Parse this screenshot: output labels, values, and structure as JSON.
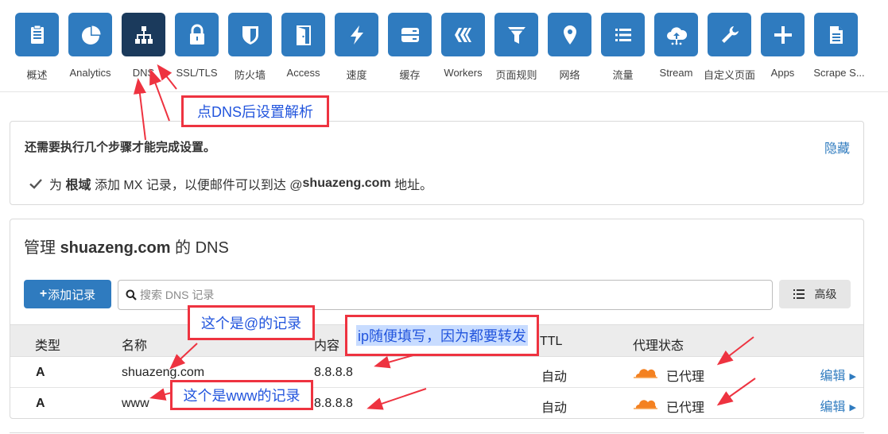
{
  "nav": {
    "items": [
      {
        "label": "概述",
        "icon": "clipboard-icon"
      },
      {
        "label": "Analytics",
        "icon": "pie-chart-icon"
      },
      {
        "label": "DNS",
        "icon": "network-icon"
      },
      {
        "label": "SSL/TLS",
        "icon": "lock-icon"
      },
      {
        "label": "防火墙",
        "icon": "shield-icon"
      },
      {
        "label": "Access",
        "icon": "door-icon"
      },
      {
        "label": "速度",
        "icon": "lightning-icon"
      },
      {
        "label": "缓存",
        "icon": "server-icon"
      },
      {
        "label": "Workers",
        "icon": "workers-icon"
      },
      {
        "label": "页面规则",
        "icon": "filter-icon"
      },
      {
        "label": "网络",
        "icon": "location-pin-icon"
      },
      {
        "label": "流量",
        "icon": "list-icon"
      },
      {
        "label": "Stream",
        "icon": "cloud-upload-icon"
      },
      {
        "label": "自定义页面",
        "icon": "wrench-icon"
      },
      {
        "label": "Apps",
        "icon": "plus-icon"
      },
      {
        "label": "Scrape S...",
        "icon": "document-icon"
      }
    ],
    "active": "DNS"
  },
  "setup": {
    "title": "还需要执行几个步骤才能完成设置。",
    "hide": "隐藏",
    "step_pre": "为",
    "step_bold": "根域",
    "step_mid": "添加 MX 记录，以便邮件可以到达 @",
    "step_domain": "shuazeng.com",
    "step_post": "地址。"
  },
  "dns": {
    "title_pre": "管理",
    "title_domain": "shuazeng.com",
    "title_post": "的 DNS",
    "add_button": "添加记录",
    "search_placeholder": "搜索 DNS 记录",
    "advanced_button": "高级",
    "columns": {
      "type": "类型",
      "name": "名称",
      "content": "内容",
      "ttl": "TTL",
      "proxy": "代理状态"
    },
    "rows": [
      {
        "type": "A",
        "name": "shuazeng.com",
        "content": "8.8.8.8",
        "ttl": "自动",
        "proxy": "已代理",
        "edit": "编辑"
      },
      {
        "type": "A",
        "name": "www",
        "content": "8.8.8.8",
        "ttl": "自动",
        "proxy": "已代理",
        "edit": "编辑"
      }
    ]
  },
  "annotations": {
    "dns_hint": "点DNS后设置解析",
    "at_record": "这个是@的记录",
    "ip_hint": "ip随便填写，因为都要转发",
    "www_record": "这个是www的记录"
  },
  "colors": {
    "accent": "#2f7bbf",
    "active_tile": "#1b3a5c",
    "annotation_border": "#ee3340",
    "annotation_text": "#2255dd",
    "proxy_cloud": "#f48120"
  }
}
